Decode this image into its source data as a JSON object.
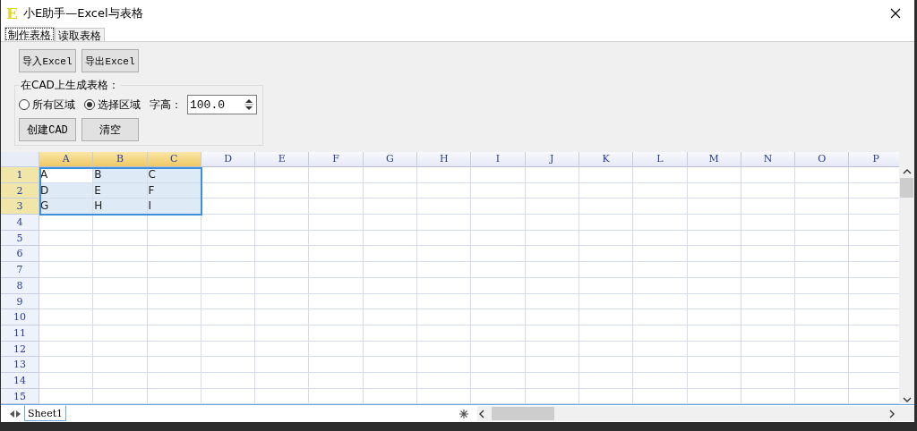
{
  "window": {
    "title": "小E助手—Excel与表格",
    "logo": "E"
  },
  "tabs": [
    {
      "label": "制作表格",
      "selected": true
    },
    {
      "label": "读取表格",
      "selected": false
    }
  ],
  "io_buttons": [
    "导入Excel",
    "导出Excel"
  ],
  "group": {
    "title": "在CAD上生成表格：",
    "radios": [
      {
        "label": "所有区域",
        "selected": false
      },
      {
        "label": "选择区域",
        "selected": true
      }
    ],
    "font_height": {
      "label": "字高：",
      "value": "100.0"
    },
    "buttons": [
      "创建CAD",
      "清空"
    ]
  },
  "sheet": {
    "columns": [
      {
        "label": "A",
        "selected": true
      },
      {
        "label": "B",
        "selected": true
      },
      {
        "label": "C",
        "selected": true
      },
      {
        "label": "D",
        "selected": false
      },
      {
        "label": "E",
        "selected": false
      },
      {
        "label": "F",
        "selected": false
      },
      {
        "label": "G",
        "selected": false
      },
      {
        "label": "H",
        "selected": false
      },
      {
        "label": "I",
        "selected": false
      },
      {
        "label": "J",
        "selected": false
      },
      {
        "label": "K",
        "selected": false
      },
      {
        "label": "L",
        "selected": false
      },
      {
        "label": "M",
        "selected": false
      },
      {
        "label": "N",
        "selected": false
      },
      {
        "label": "O",
        "selected": false
      },
      {
        "label": "P",
        "selected": false
      }
    ],
    "rows": [
      {
        "label": "1",
        "selected": true,
        "cells": [
          "A",
          "B",
          "C"
        ]
      },
      {
        "label": "2",
        "selected": true,
        "cells": [
          "D",
          "E",
          "F"
        ]
      },
      {
        "label": "3",
        "selected": true,
        "cells": [
          "G",
          "H",
          "I"
        ]
      },
      {
        "label": "4",
        "selected": false,
        "cells": []
      },
      {
        "label": "5",
        "selected": false,
        "cells": []
      },
      {
        "label": "6",
        "selected": false,
        "cells": []
      },
      {
        "label": "7",
        "selected": false,
        "cells": []
      },
      {
        "label": "8",
        "selected": false,
        "cells": []
      },
      {
        "label": "9",
        "selected": false,
        "cells": []
      },
      {
        "label": "10",
        "selected": false,
        "cells": []
      },
      {
        "label": "11",
        "selected": false,
        "cells": []
      },
      {
        "label": "12",
        "selected": false,
        "cells": []
      },
      {
        "label": "13",
        "selected": false,
        "cells": []
      },
      {
        "label": "14",
        "selected": false,
        "cells": []
      },
      {
        "label": "15",
        "selected": false,
        "cells": []
      }
    ],
    "sheet_tabs": [
      {
        "label": "Sheet1",
        "selected": true
      }
    ]
  }
}
